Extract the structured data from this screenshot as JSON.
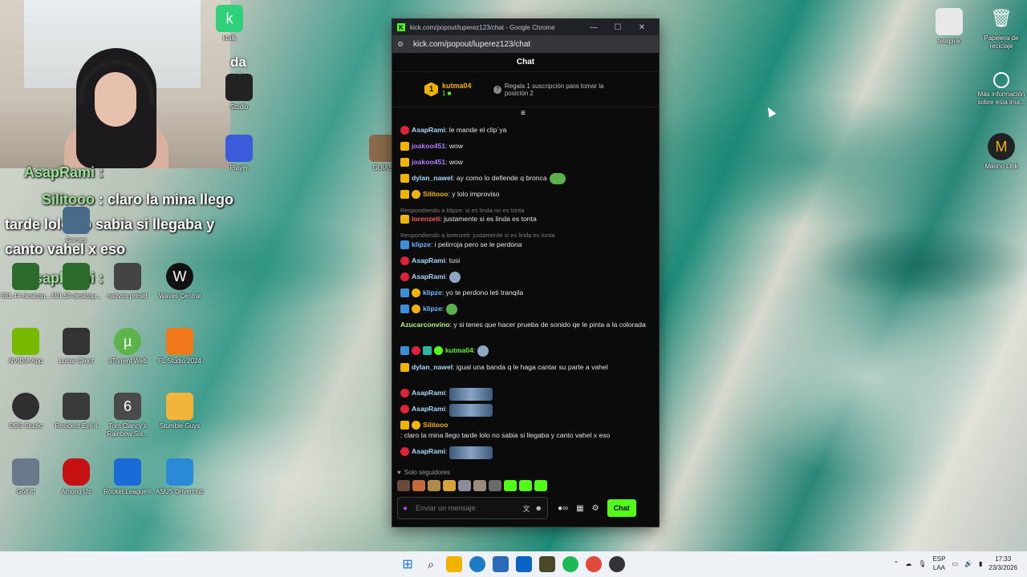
{
  "overlay": {
    "line1_name": "AsapRami :",
    "line2_name": "Silitooo",
    "line2_text": " : claro la mina llego",
    "line3": "tarde lolo no sabia si llegaba y",
    "line4": "canto vahel x eso",
    "line5_name": "AsapRami :",
    "stream_text_1": "da",
    "stream_text_2": "el"
  },
  "desktop_icons": {
    "ktalk": "ktalk",
    "studio": "Studio",
    "player": "Player",
    "guia": "GUÍAS",
    "games": "Games",
    "dl1": "591.44-desktop...",
    "dl2": "591.59-desktop...",
    "nativos": "nativos preset",
    "waves": "Waves Central",
    "nvidia": "NVIDIA App",
    "lunar": "Lunar Client",
    "utorrent": "uTorrent Web",
    "fl": "FL Studio 2024",
    "obs": "OBS Studio",
    "re4": "Resident Evil 4",
    "r6": "Tom Clancy's Rainbow Six...",
    "stumble": "Stumble Guys",
    "golf": "Golf it!",
    "amongus": "Among Us",
    "rocket": "Rocket League®",
    "asus": "ASUS DriverHub",
    "tetepink": "tetepink",
    "recycle": "Papelera de reciclaje",
    "moreinfo": "Más información sobre esta ima...",
    "maono": "Maono Link"
  },
  "window": {
    "title": "kick.com/popout/luperez123/chat - Google Chrome",
    "url": "kick.com/popout/luperez123/chat",
    "header": "Chat"
  },
  "pinned": {
    "rank": "1",
    "name": "kutma04",
    "count": "1",
    "gift_text": "Regala 1 suscripción para tomar la posición 2"
  },
  "messages": [
    {
      "name": "AsapRami",
      "color": "#a6d9ff",
      "text": ": le mande el clip`ya"
    },
    {
      "name": "joakoo451",
      "color": "#b07bff",
      "text": ": wow"
    },
    {
      "name": "joakoo451",
      "color": "#b07bff",
      "text": ": wow"
    },
    {
      "name": "dylan_nawel",
      "color": "#a6d9ff",
      "text": ": ay como lo defiende q bronca"
    },
    {
      "name": "Silitooo",
      "color": "#f0b400",
      "text": ": y lolo improviso"
    },
    {
      "reply": "Respondiendo a klipze: si es linda no es tonta"
    },
    {
      "name": "lorenzeti",
      "color": "#ff5a5a",
      "text": ": justamente si es linda es tonta"
    },
    {
      "reply": "Respondiendo a lorenzeti: justamente si es linda es tonta"
    },
    {
      "name": "klipze",
      "color": "#6fb9ff",
      "text": ": i pelirroja pero se le perdona"
    },
    {
      "name": "AsapRami",
      "color": "#a6d9ff",
      "text": ": tusi"
    },
    {
      "name": "AsapRami",
      "color": "#a6d9ff",
      "text": ":"
    },
    {
      "name": "klipze",
      "color": "#6fb9ff",
      "text": ": yo te perdono leti tranqila"
    },
    {
      "name": "klipze",
      "color": "#6fb9ff",
      "text": ":"
    },
    {
      "name": "Azucarconvino",
      "color": "#b6f07a",
      "text": ": y si tenes que hacer prueba de sonido qe le pinta a la colorada"
    },
    {
      "name": "kutma04",
      "color": "#53fc18",
      "text": ":"
    },
    {
      "name": "dylan_nawel",
      "color": "#a6d9ff",
      "text": ": igual una banda q le haga cantar su parte a vahel"
    },
    {
      "name": "AsapRami",
      "color": "#a6d9ff",
      "text": ":"
    },
    {
      "name": "AsapRami",
      "color": "#a6d9ff",
      "text": ":"
    },
    {
      "name": "Silitooo",
      "color": "#f0b400",
      "text": ": claro la mina llego tarde lolo no sabia si llegaba y canto vahel x eso"
    },
    {
      "name": "AsapRami",
      "color": "#a6d9ff",
      "text": ":"
    }
  ],
  "footer": {
    "followers_label": "Solo seguidores",
    "input_placeholder": "Enviar un mensaje",
    "chat_button": "Chat"
  },
  "tray": {
    "lang1": "ESP",
    "lang2": "LAA",
    "time": "17:33",
    "date": "23/3/2026"
  },
  "colors": {
    "kick_green": "#53fc18",
    "gold": "#f0b400"
  }
}
